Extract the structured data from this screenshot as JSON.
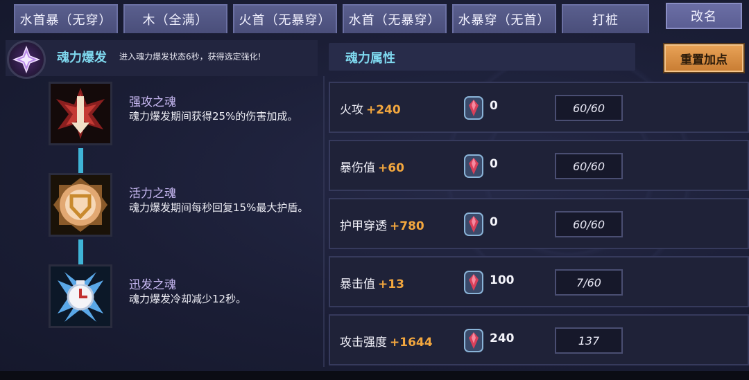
{
  "tabs": [
    {
      "label": "水首暴（无穿）"
    },
    {
      "label": "木（全满）"
    },
    {
      "label": "火首（无暴穿）"
    },
    {
      "label": "水首（无暴穿）"
    },
    {
      "label": "水暴穿（无首）"
    },
    {
      "label": "打桩"
    }
  ],
  "rename_button": "改名",
  "soul_burst": {
    "title": "魂力爆发",
    "description": "进入魂力爆发状态6秒，获得选定强化!"
  },
  "souls": [
    {
      "name": "强攻之魂",
      "description": "魂力爆发期间获得25%的伤害加成。",
      "icon": "attack-soul-icon"
    },
    {
      "name": "活力之魂",
      "description": "魂力爆发期间每秒回复15%最大护盾。",
      "icon": "vitality-soul-icon"
    },
    {
      "name": "迅发之魂",
      "description": "魂力爆发冷却减少12秒。",
      "icon": "swift-soul-icon"
    }
  ],
  "attributes": {
    "title": "魂力属性",
    "reset_button": "重置加点",
    "rows": [
      {
        "name": "火攻",
        "bonus": "+240",
        "gems": "0",
        "value": "60/60"
      },
      {
        "name": "暴伤值",
        "bonus": "+60",
        "gems": "0",
        "value": "60/60"
      },
      {
        "name": "护甲穿透",
        "bonus": "+780",
        "gems": "0",
        "value": "60/60"
      },
      {
        "name": "暴击值",
        "bonus": "+13",
        "gems": "100",
        "value": "7/60"
      },
      {
        "name": "攻击强度",
        "bonus": "+1644",
        "gems": "240",
        "value": "137"
      }
    ]
  },
  "colors": {
    "accent_cyan": "#7fd9ef",
    "bonus_orange": "#f3a73e",
    "tab_purple": "#5a5f8e",
    "reset_orange": "#e8a256"
  }
}
